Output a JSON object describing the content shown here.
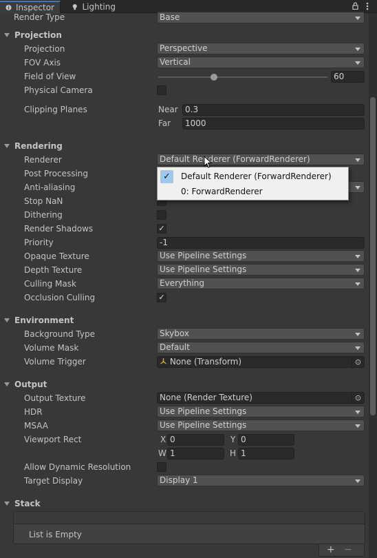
{
  "tabs": [
    {
      "label": "Inspector",
      "icon": "info-icon"
    },
    {
      "label": "Lighting",
      "icon": "bulb-icon"
    }
  ],
  "render_type": {
    "label": "Render Type",
    "value": "Base"
  },
  "projection_section": {
    "title": "Projection",
    "projection": {
      "label": "Projection",
      "value": "Perspective"
    },
    "fov_axis": {
      "label": "FOV Axis",
      "value": "Vertical"
    },
    "field_of_view": {
      "label": "Field of View",
      "value": "60",
      "slider_fraction": 0.33
    },
    "physical_camera": {
      "label": "Physical Camera",
      "checked": false
    },
    "clipping_planes": {
      "label": "Clipping Planes",
      "near_label": "Near",
      "near_value": "0.3",
      "far_label": "Far",
      "far_value": "1000"
    }
  },
  "rendering_section": {
    "title": "Rendering",
    "renderer": {
      "label": "Renderer",
      "value": "Default Renderer (ForwardRenderer)"
    },
    "post_processing": {
      "label": "Post Processing"
    },
    "anti_aliasing": {
      "label": "Anti-aliasing"
    },
    "stop_nan": {
      "label": "Stop NaN"
    },
    "dithering": {
      "label": "Dithering",
      "checked": false
    },
    "render_shadows": {
      "label": "Render Shadows",
      "checked": true
    },
    "priority": {
      "label": "Priority",
      "value": "-1"
    },
    "opaque_texture": {
      "label": "Opaque Texture",
      "value": "Use Pipeline Settings"
    },
    "depth_texture": {
      "label": "Depth Texture",
      "value": "Use Pipeline Settings"
    },
    "culling_mask": {
      "label": "Culling Mask",
      "value": "Everything"
    },
    "occlusion_culling": {
      "label": "Occlusion Culling",
      "checked": true
    }
  },
  "renderer_popup": {
    "items": [
      {
        "label": "Default Renderer (ForwardRenderer)",
        "selected": true
      },
      {
        "label": "0: ForwardRenderer",
        "selected": false
      }
    ]
  },
  "environment_section": {
    "title": "Environment",
    "background_type": {
      "label": "Background Type",
      "value": "Skybox"
    },
    "volume_mask": {
      "label": "Volume Mask",
      "value": "Default"
    },
    "volume_trigger": {
      "label": "Volume Trigger",
      "value": "None (Transform)"
    }
  },
  "output_section": {
    "title": "Output",
    "output_texture": {
      "label": "Output Texture",
      "value": "None (Render Texture)"
    },
    "hdr": {
      "label": "HDR",
      "value": "Use Pipeline Settings"
    },
    "msaa": {
      "label": "MSAA",
      "value": "Use Pipeline Settings"
    },
    "viewport_rect": {
      "label": "Viewport Rect",
      "x_label": "X",
      "x": "0",
      "y_label": "Y",
      "y": "0",
      "w_label": "W",
      "w": "1",
      "h_label": "H",
      "h": "1"
    },
    "allow_dynamic_resolution": {
      "label": "Allow Dynamic Resolution",
      "checked": false
    },
    "target_display": {
      "label": "Target Display",
      "value": "Display 1"
    }
  },
  "stack_section": {
    "title": "Stack",
    "empty_text": "List is Empty",
    "add_symbol": "+",
    "remove_symbol": "−"
  }
}
